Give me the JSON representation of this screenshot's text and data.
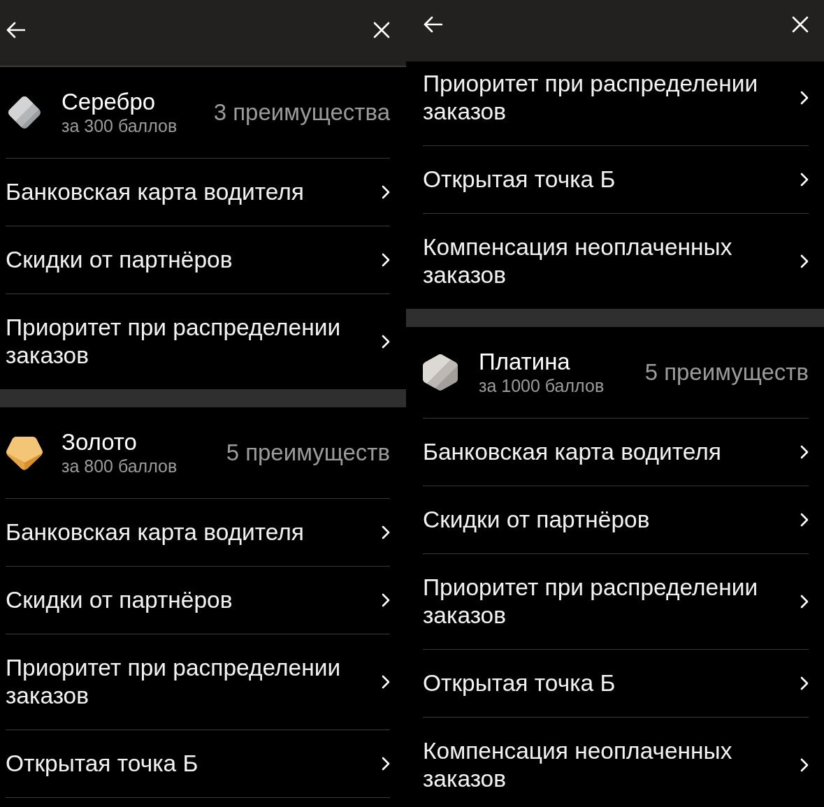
{
  "panels": [
    {
      "sections": [
        {
          "tier": {
            "kind": "silver",
            "name": "Серебро",
            "price": "за 300 баллов",
            "count": "3 преимущества"
          },
          "items": [
            "Банковская карта водителя",
            "Скидки от партнёров",
            "Приоритет при распределении заказов"
          ]
        },
        {
          "tier": {
            "kind": "gold",
            "name": "Золото",
            "price": "за 800 баллов",
            "count": "5 преимуществ"
          },
          "items": [
            "Банковская карта водителя",
            "Скидки от партнёров",
            "Приоритет при распределении заказов",
            "Открытая точка Б"
          ]
        }
      ]
    },
    {
      "sections": [
        {
          "items": [
            "Приоритет при распределении заказов",
            "Открытая точка Б",
            "Компенсация неоплаченных заказов"
          ]
        },
        {
          "tier": {
            "kind": "platinum",
            "name": "Платина",
            "price": "за 1000 баллов",
            "count": "5 преимуществ"
          },
          "items": [
            "Банковская карта водителя",
            "Скидки от партнёров",
            "Приоритет при распределении заказов",
            "Открытая точка Б",
            "Компенсация неоплаченных заказов"
          ]
        }
      ]
    }
  ]
}
